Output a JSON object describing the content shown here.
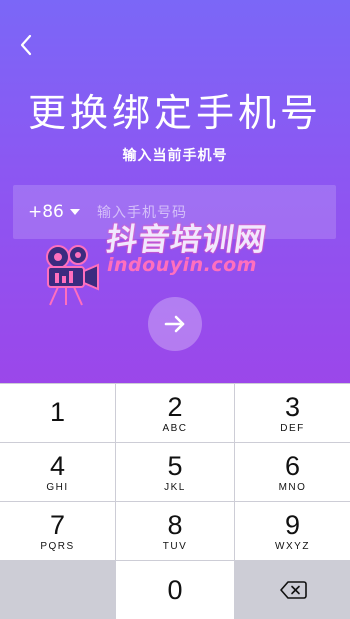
{
  "header": {
    "title": "更换绑定手机号",
    "subtitle": "输入当前手机号"
  },
  "phone": {
    "country_code": "+86",
    "placeholder": "输入手机号码",
    "value": ""
  },
  "watermark": {
    "line1": "抖音培训网",
    "line2": "indouyin.com"
  },
  "keypad": {
    "keys": [
      {
        "num": "1",
        "letters": ""
      },
      {
        "num": "2",
        "letters": "ABC"
      },
      {
        "num": "3",
        "letters": "DEF"
      },
      {
        "num": "4",
        "letters": "GHI"
      },
      {
        "num": "5",
        "letters": "JKL"
      },
      {
        "num": "6",
        "letters": "MNO"
      },
      {
        "num": "7",
        "letters": "PQRS"
      },
      {
        "num": "8",
        "letters": "TUV"
      },
      {
        "num": "9",
        "letters": "WXYZ"
      },
      {
        "num": "0",
        "letters": ""
      }
    ]
  },
  "colors": {
    "gradient_top": "#7b67f7",
    "gradient_bottom": "#9b47ea",
    "keypad_bg": "#cdcdd6",
    "watermark_pink": "#ff6fbe"
  },
  "icons": {
    "back": "chevron-left-icon",
    "country_caret": "caret-down-icon",
    "next": "arrow-right-icon",
    "delete": "backspace-icon"
  }
}
